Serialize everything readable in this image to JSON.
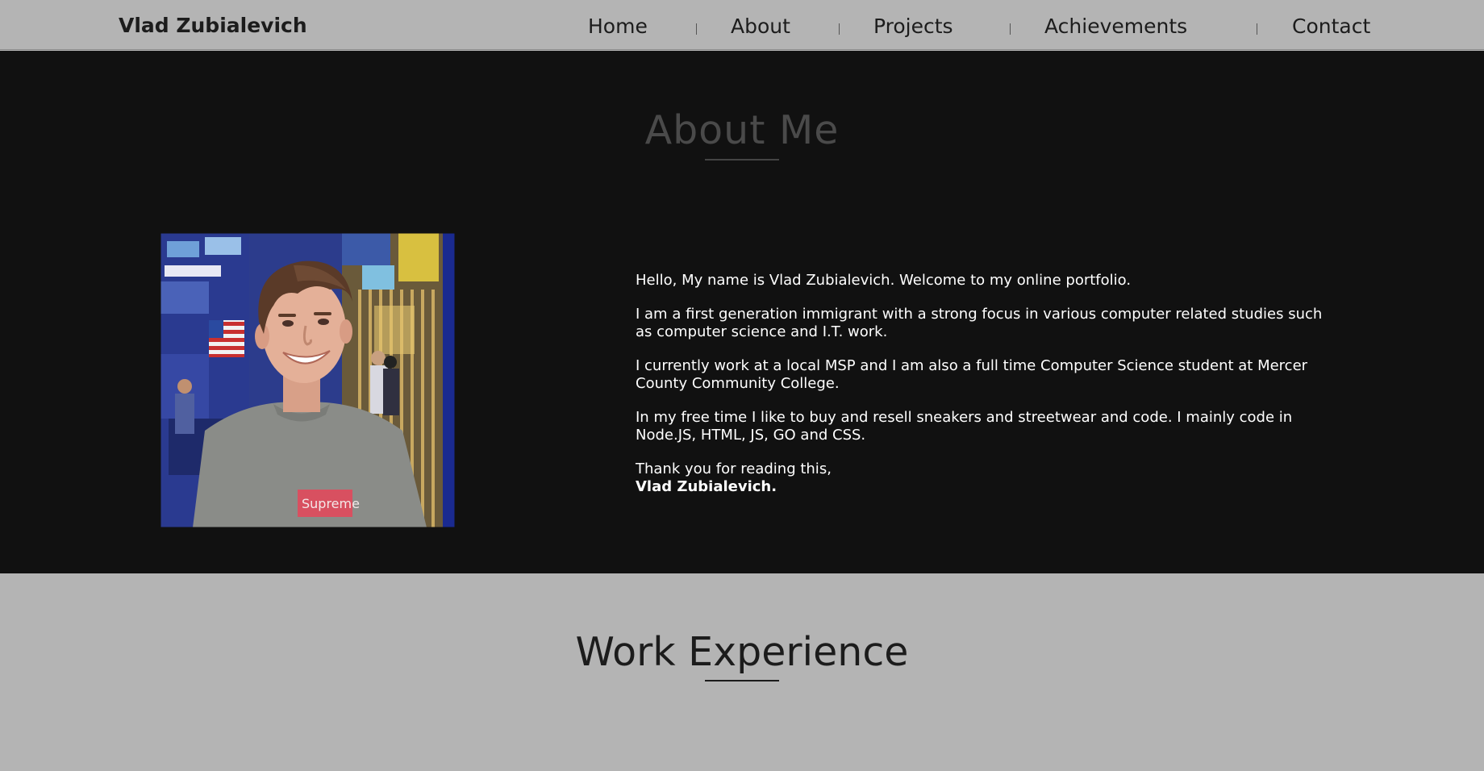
{
  "header": {
    "brand": "Vlad Zubialevich",
    "nav": [
      "Home",
      "About",
      "Projects",
      "Achievements",
      "Contact"
    ]
  },
  "about": {
    "title": "About Me",
    "paragraphs": [
      "Hello, My name is Vlad Zubialevich. Welcome to my online portfolio.",
      "I am a first generation immigrant with a strong focus in various computer related studies such as computer science and I.T. work.",
      "I currently work at a local MSP and I am also a full time Computer Science student at Mercer County Community College.",
      "In my free time I like to buy and resell sneakers and streetwear and code. I mainly code in Node.JS, HTML, JS, GO and CSS."
    ],
    "closing": "Thank you for reading this,",
    "signature": "Vlad Zubialevich.",
    "photo_shirt_text": "Supreme"
  },
  "work": {
    "title": "Work Experience"
  },
  "colors": {
    "nav_bg": "#b4b4b4",
    "about_bg": "#111111",
    "about_title": "#4a4a4a",
    "text_light": "#ffffff",
    "text_dark": "#1c1c1c"
  }
}
